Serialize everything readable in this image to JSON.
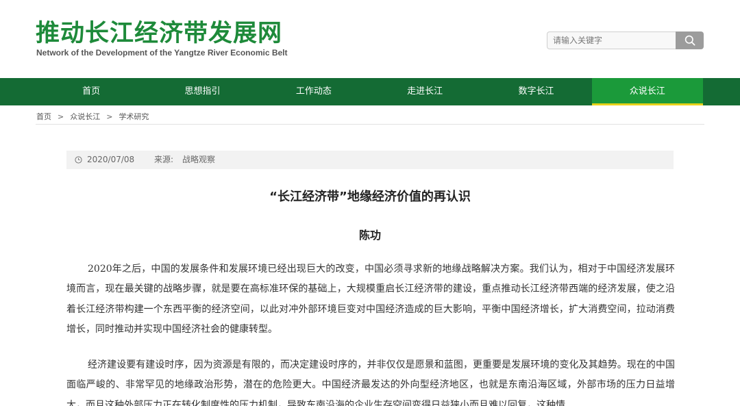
{
  "site": {
    "title": "推动长江经济带发展网",
    "subtitle": "Network of the Development of the Yangtze River Economic Belt"
  },
  "search": {
    "placeholder": "请输入关键字",
    "icon": "search-icon"
  },
  "nav": {
    "items": [
      {
        "label": "首页"
      },
      {
        "label": "思想指引"
      },
      {
        "label": "工作动态"
      },
      {
        "label": "走进长江"
      },
      {
        "label": "数字长江"
      },
      {
        "label": "众说长江"
      }
    ],
    "active_index": 5
  },
  "breadcrumb": {
    "items": [
      "首页",
      "众说长江",
      "学术研究"
    ],
    "separator": ">"
  },
  "meta": {
    "date": "2020/07/08",
    "source_label": "来源:",
    "source": "战略观察"
  },
  "article": {
    "title": "“长江经济带”地缘经济价值的再认识",
    "author": "陈功",
    "paragraphs": [
      "2020年之后，中国的发展条件和发展环境已经出现巨大的改变，中国必须寻求新的地缘战略解决方案。我们认为，相对于中国经济发展环境而言，现在最关键的战略步骤，就是要在高标准环保的基础上，大规模重启长江经济带的建设，重点推动长江经济带西端的经济发展，使之沿着长江经济带构建一个东西平衡的经济空间，以此对冲外部环境巨变对中国经济造成的巨大影响，平衡中国经济增长，扩大消费空间，拉动消费增长，同时推动并实现中国经济社会的健康转型。",
      "经济建设要有建设时序，因为资源是有限的，而决定建设时序的，并非仅仅是愿景和蓝图，更重要是发展环境的变化及其趋势。现在的中国面临严峻的、非常罕见的地缘政治形势，潜在的危险更大。中国经济最发达的外向型经济地区，也就是东南沿海区域，外部市场的压力日益增大，而且这种外部压力正在转化制度性的压力机制，导致东南沿海的企业生存空间变得日益狭小而且难以回复，这种情"
    ]
  },
  "colors": {
    "brand_green": "#1e8a3a",
    "nav_bg": "#146b34",
    "nav_active_bg": "#1b9a3a",
    "nav_active_underline": "#e8d21a",
    "search_button": "#9c9c9c"
  }
}
